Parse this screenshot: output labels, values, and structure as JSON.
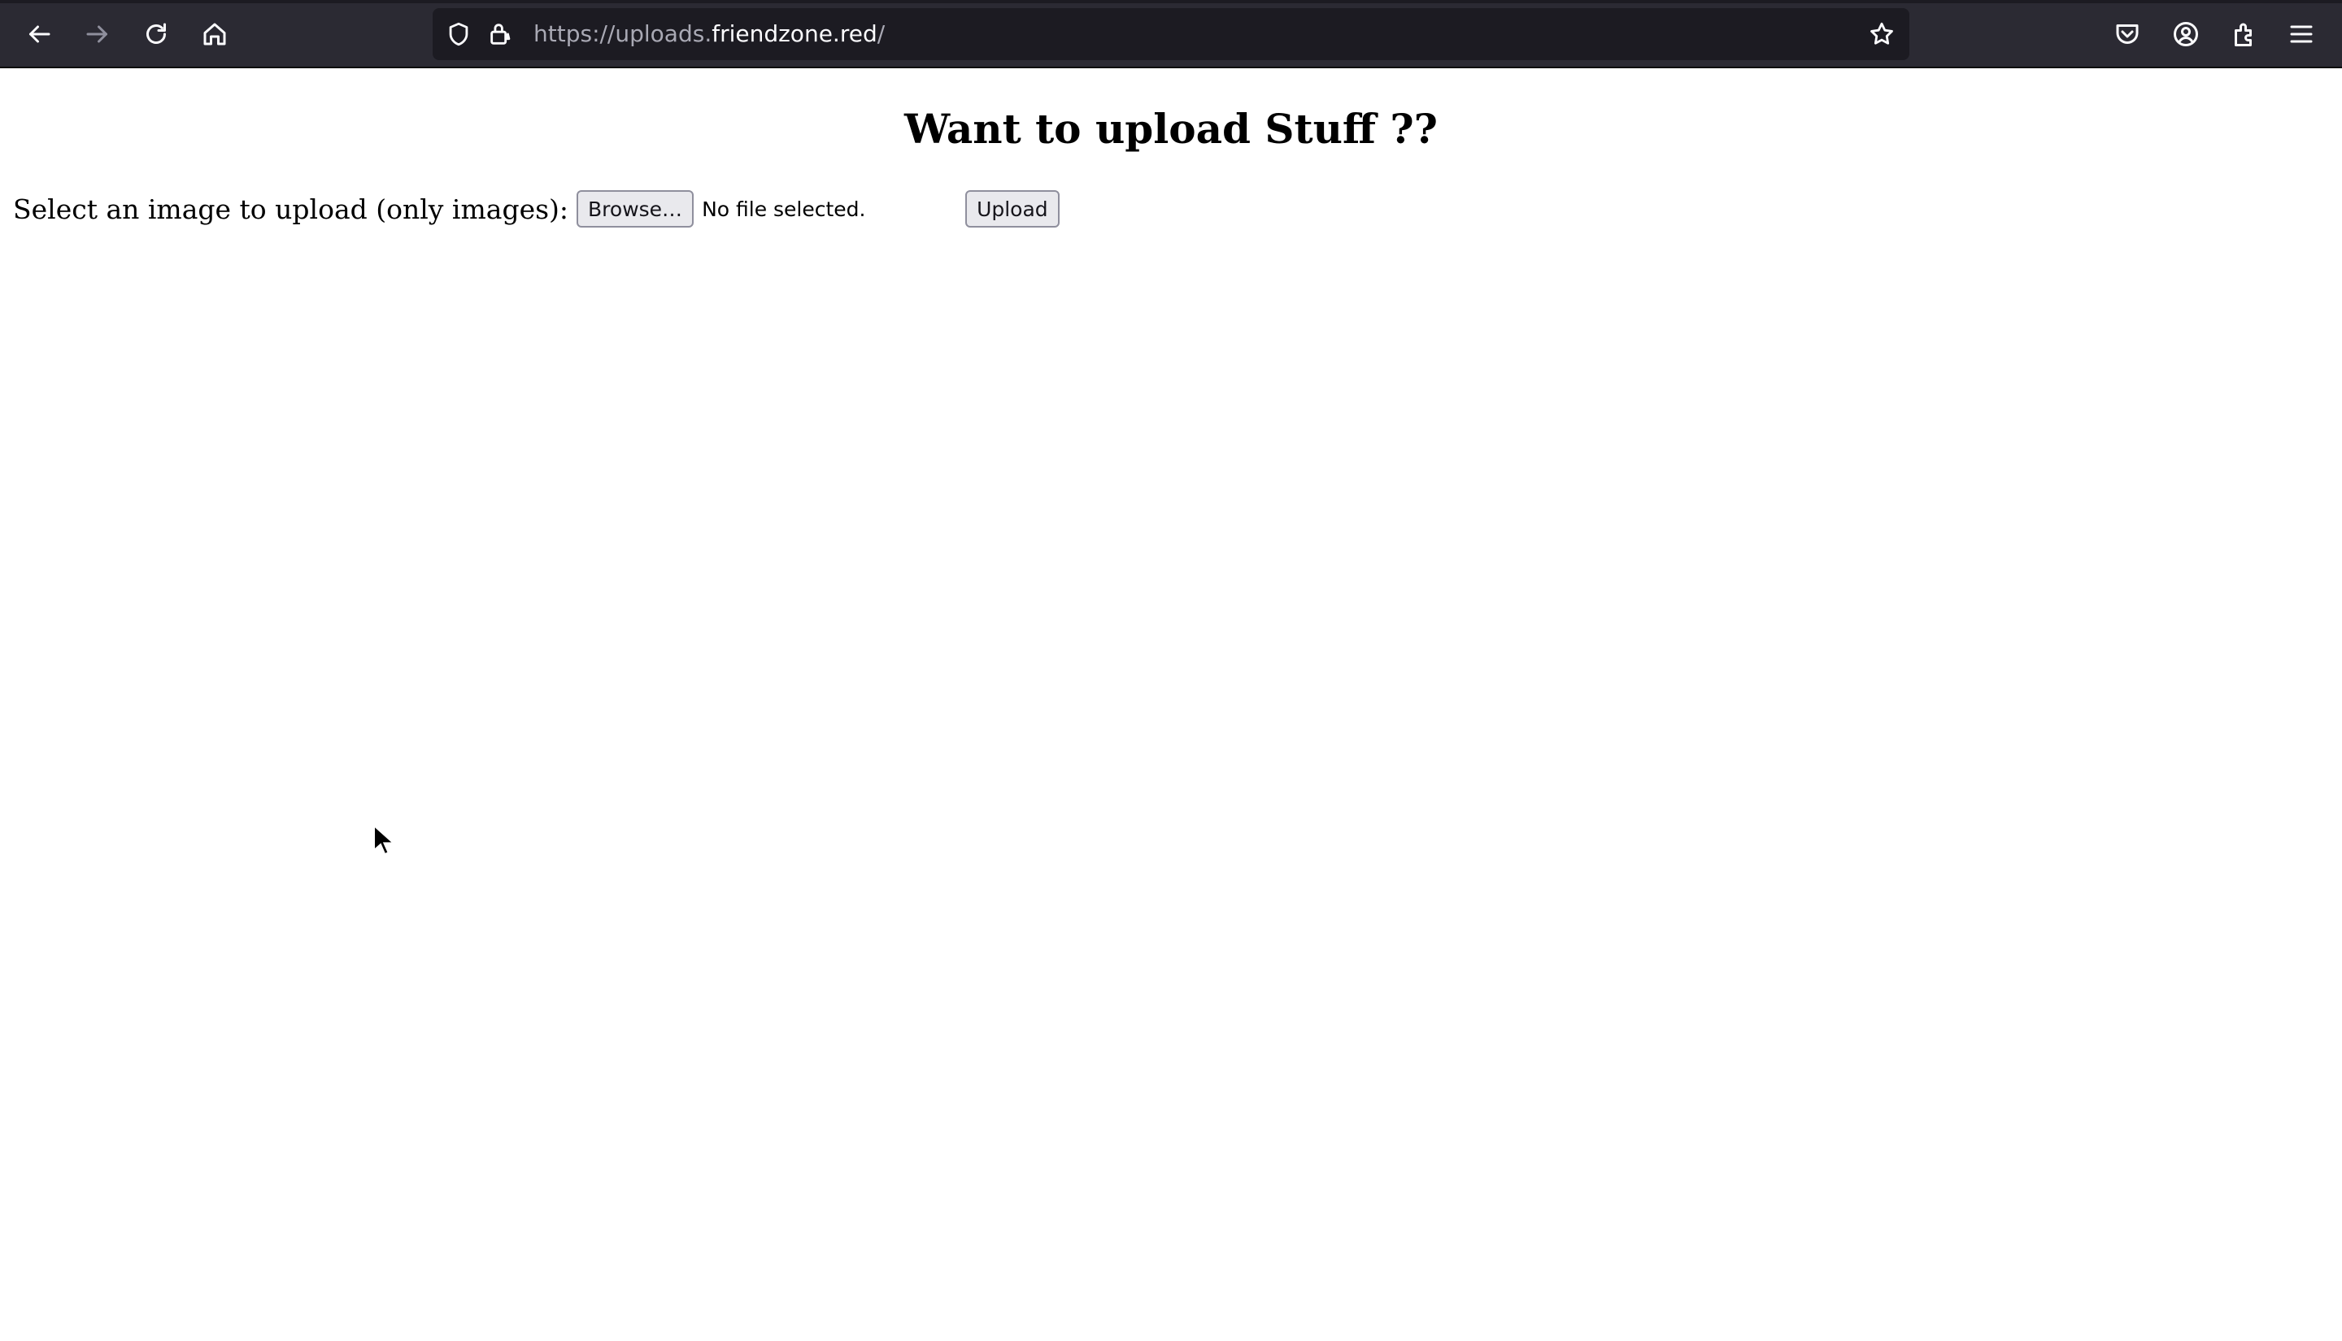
{
  "browser": {
    "url": {
      "prefix": "https://uploads.",
      "domain": "friendzone.red",
      "suffix": "/"
    },
    "icons": {
      "back": "arrow-left-icon",
      "forward": "arrow-right-icon",
      "reload": "reload-icon",
      "home": "home-icon",
      "tracking_protection": "shield-icon",
      "connection": "lock-warning-icon",
      "bookmark": "star-icon",
      "pocket": "pocket-icon",
      "account": "account-icon",
      "extensions": "puzzle-icon",
      "menu": "hamburger-menu-icon"
    },
    "colors": {
      "toolbar_bg": "#2b2a33",
      "urlbar_bg": "#1c1b22",
      "icon": "#fbfbfe"
    }
  },
  "page": {
    "title": "Want to upload Stuff ??",
    "form": {
      "label": "Select an image to upload (only images):",
      "browse_label": "Browse…",
      "file_status": "No file selected.",
      "upload_label": "Upload"
    }
  }
}
